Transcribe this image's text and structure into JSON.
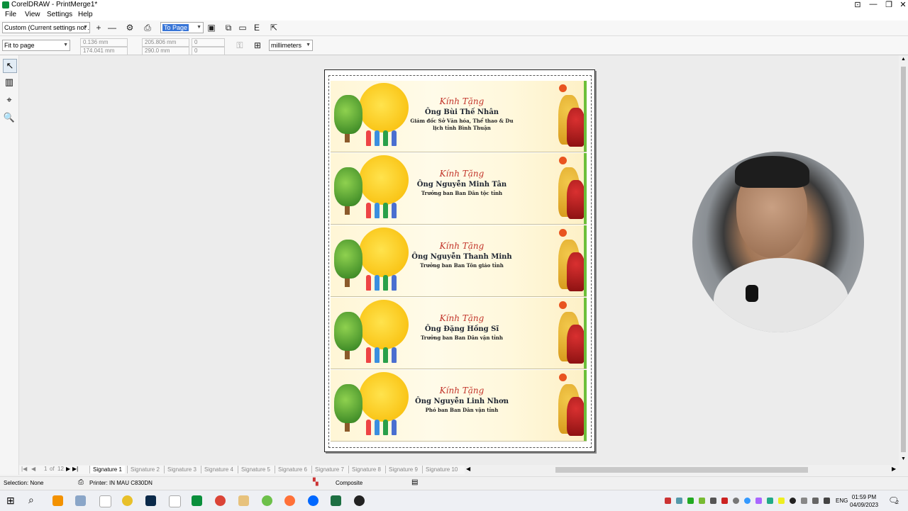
{
  "window": {
    "title": "CorelDRAW - PrintMerge1*"
  },
  "menu": [
    "File",
    "View",
    "Settings",
    "Help"
  ],
  "toolbar1": {
    "preset": "Custom (Current settings not ...",
    "fit_mode": "To Page"
  },
  "toolbar2": {
    "zoom": "Fit to page",
    "pos_x": "0.136 mm",
    "pos_y": "174.041 mm",
    "width": "205.806 mm",
    "height": "290.0 mm",
    "angle1": "0",
    "angle2": "0",
    "units": "millimeters"
  },
  "cards": [
    {
      "greeting": "Kính Tặng",
      "name": "Ông Bùi Thế Nhân",
      "role": "Giám đốc Sở Văn hóa, Thể thao & Du lịch tỉnh Bình Thuận"
    },
    {
      "greeting": "Kính Tặng",
      "name": "Ông Nguyễn Minh Tân",
      "role": "Trưởng ban Ban Dân tộc tỉnh"
    },
    {
      "greeting": "Kính Tặng",
      "name": "Ông Nguyễn Thanh Minh",
      "role": "Trưởng ban Ban Tôn giáo tỉnh"
    },
    {
      "greeting": "Kính Tặng",
      "name": "Ông Đặng Hồng Sĩ",
      "role": "Trưởng ban Ban Dân vận tỉnh"
    },
    {
      "greeting": "Kính Tặng",
      "name": "Ông Nguyễn Linh Nhơn",
      "role": "Phó ban Ban Dân vận tỉnh"
    }
  ],
  "pager": {
    "current": "1",
    "of_label": "of",
    "total": "12"
  },
  "signature_tabs": [
    "Signature 1",
    "Signature 2",
    "Signature 3",
    "Signature 4",
    "Signature 5",
    "Signature 6",
    "Signature 7",
    "Signature 8",
    "Signature 9",
    "Signature 10"
  ],
  "status": {
    "selection": "Selection: None",
    "printer": "Printer: IN MAU C830DN",
    "mode": "Composite"
  },
  "taskbar": {
    "lang": "ENG",
    "time": "01:59 PM",
    "date": "04/09/2023",
    "notification_count": "2"
  }
}
